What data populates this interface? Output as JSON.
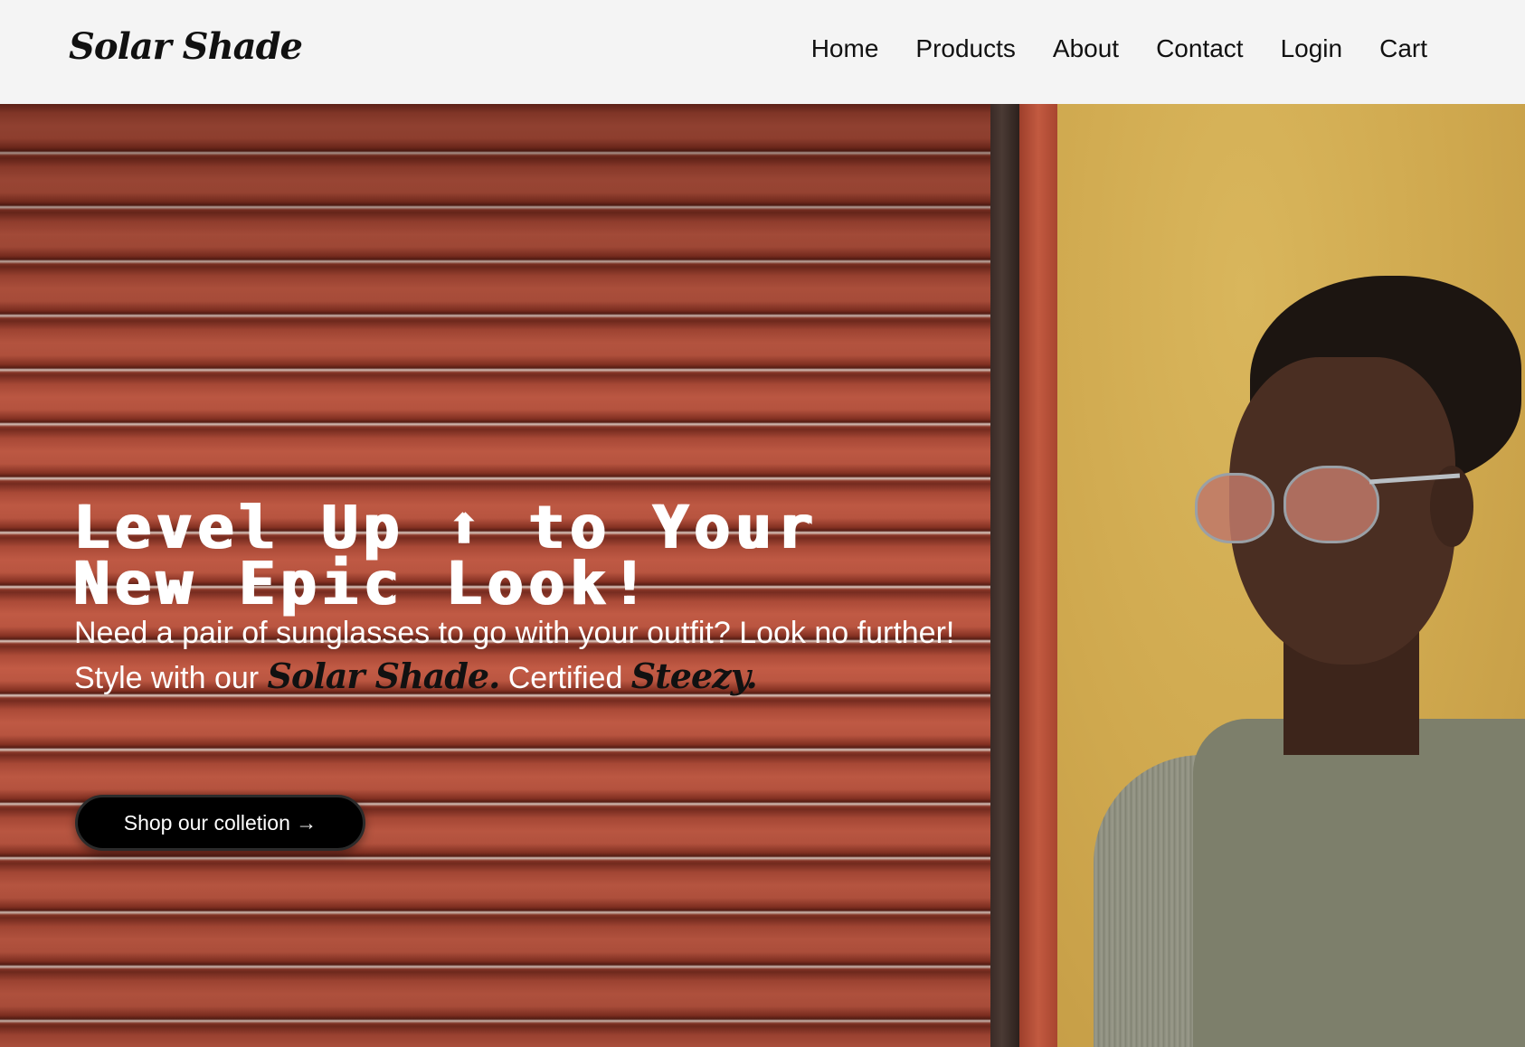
{
  "brand": {
    "logo_text": "Solar Shade"
  },
  "nav": {
    "items": [
      {
        "label": "Home"
      },
      {
        "label": "Products"
      },
      {
        "label": "About"
      },
      {
        "label": "Contact"
      },
      {
        "label": "Login"
      },
      {
        "label": "Cart"
      }
    ]
  },
  "hero": {
    "headline_line1": "Level Up ⬆ to Your",
    "headline_line2": "New Epic Look!",
    "sub_line1": "Need a pair of sunglasses to go with your outfit? Look no further!",
    "sub_line2_prefix": "Style with our ",
    "sub_brand": "Solar Shade.",
    "sub_line2_mid": " Certified ",
    "sub_steezy": "Steezy.",
    "cta_label": "Shop our colletion →",
    "image_alt_icon": "person-wearing-sunglasses-photo"
  },
  "colors": {
    "nav_bg": "#f4f4f4",
    "cta_bg": "#000000",
    "cta_text": "#ffffff",
    "headline": "#ffffff",
    "shutter": "#b14a36",
    "wall": "#cfa84e"
  }
}
